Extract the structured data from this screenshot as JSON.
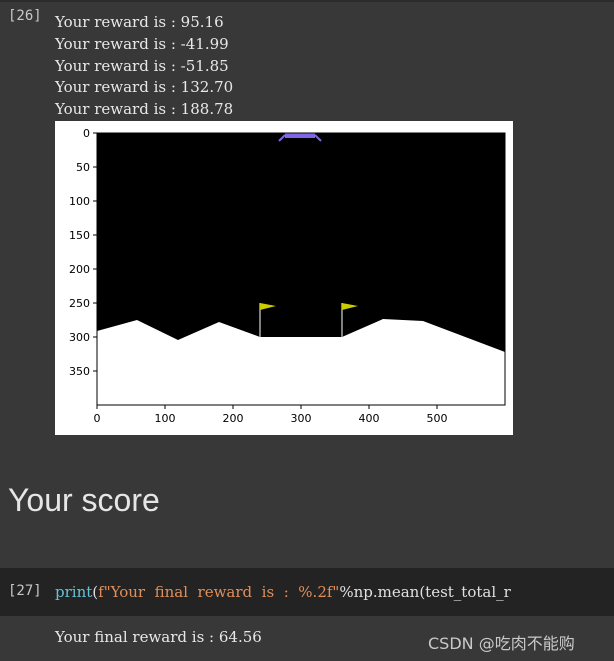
{
  "cell26": {
    "prompt": "[26]",
    "outputs": [
      "Your reward is : 95.16",
      "Your reward is : -41.99",
      "Your reward is : -51.85",
      "Your reward is : 132.70",
      "Your reward is : 188.78"
    ]
  },
  "plot": {
    "x_ticks": [
      "0",
      "100",
      "200",
      "300",
      "400",
      "500"
    ],
    "y_ticks": [
      "0",
      "50",
      "100",
      "150",
      "200",
      "250",
      "300",
      "350"
    ],
    "colors": {
      "sky": "#000000",
      "ground": "#ffffff",
      "flag": "#cccc00",
      "lander": "#8066e6"
    }
  },
  "markdown": {
    "heading": "Your score"
  },
  "cell27": {
    "prompt": "[27]",
    "code": {
      "fn": "print",
      "open": "(",
      "fprefix": "f",
      "quote_open": "\"",
      "text": "Your  final  reward  is  :  ",
      "fmt": "%.2f",
      "quote_close": "\"",
      "rest": "%np.mean(test_total_r"
    },
    "output": "Your final reward is : 64.56"
  },
  "watermark": "CSDN @吃肉不能购"
}
